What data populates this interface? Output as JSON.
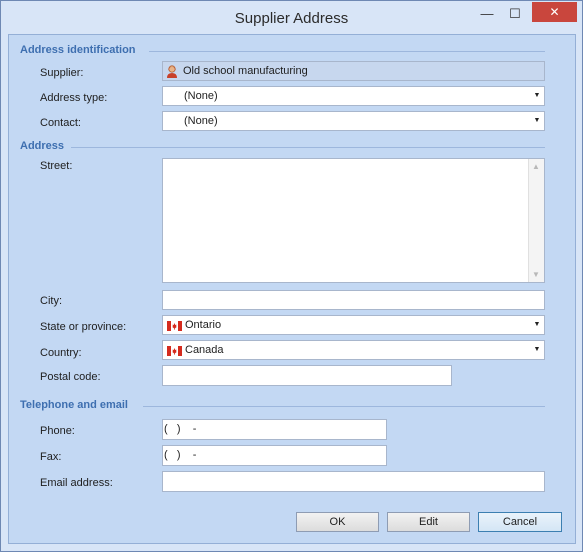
{
  "window": {
    "title": "Supplier Address",
    "minimize_glyph": "—",
    "maximize_glyph": "☐",
    "close_glyph": "✕"
  },
  "sections": {
    "identification": "Address identification",
    "address": "Address",
    "telephone": "Telephone and email"
  },
  "fields": {
    "supplier": {
      "label": "Supplier:",
      "value": "Old school manufacturing",
      "icon": "person-icon"
    },
    "address_type": {
      "label": "Address type:",
      "value": "(None)"
    },
    "contact": {
      "label": "Contact:",
      "value": "(None)"
    },
    "street": {
      "label": "Street:",
      "value": ""
    },
    "city": {
      "label": "City:",
      "value": ""
    },
    "state": {
      "label": "State or province:",
      "value": "Ontario",
      "icon": "canada-flag-icon"
    },
    "country": {
      "label": "Country:",
      "value": "Canada",
      "icon": "canada-flag-icon"
    },
    "postal_code": {
      "label": "Postal code:",
      "value": ""
    },
    "phone": {
      "label": "Phone:",
      "value": "(   )    -"
    },
    "fax": {
      "label": "Fax:",
      "value": "(   )    -"
    },
    "email": {
      "label": "Email address:",
      "value": ""
    }
  },
  "buttons": {
    "ok": "OK",
    "edit": "Edit",
    "cancel": "Cancel"
  },
  "colors": {
    "accent": "#3e6fb0",
    "close_button": "#c9463d",
    "client_bg": "#c3d8f3"
  }
}
